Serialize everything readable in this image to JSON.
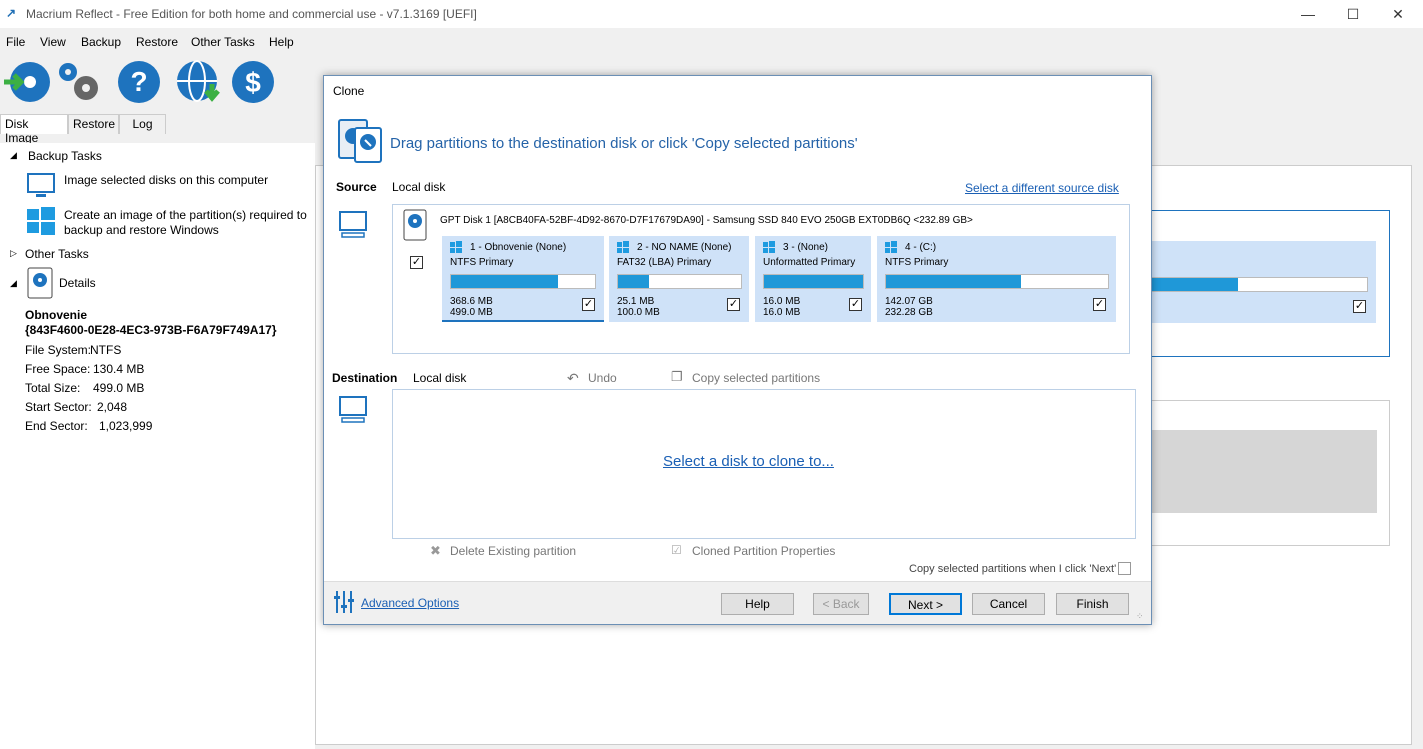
{
  "titlebar": {
    "title": "Macrium Reflect - Free Edition for both home and commercial use - v7.1.3169  [UEFI]"
  },
  "menu": [
    "File",
    "View",
    "Backup",
    "Restore",
    "Other Tasks",
    "Help"
  ],
  "left_tabs": [
    "Disk Image",
    "Restore",
    "Log"
  ],
  "left": {
    "backup_tasks": "Backup Tasks",
    "task1": "Image selected disks on this computer",
    "task2a": "Create an image of the partition(s) required to",
    "task2b": "backup and restore Windows",
    "other_tasks": "Other Tasks",
    "details": "Details",
    "part_name": "Obnovenie",
    "part_guid": "{843F4600-0E28-4EC3-973B-F6A79F749A17}",
    "fs_label": "File System:",
    "fs_value": "NTFS",
    "free_label": "Free Space:",
    "free_value": "130.4 MB",
    "total_label": "Total Size:",
    "total_value": "499.0 MB",
    "start_label": "Start Sector:",
    "start_value": "2,048",
    "end_label": "End Sector:",
    "end_value": "1,023,999"
  },
  "dialog": {
    "title": "Clone",
    "header": "Drag partitions to the destination disk or click 'Copy selected partitions'",
    "source_label": "Source",
    "source_disk_type": "Local disk",
    "select_source": "Select a different source disk",
    "disk_info": "GPT Disk 1 [A8CB40FA-52BF-4D92-8670-D7F17679DA90] - Samsung SSD 840 EVO 250GB EXT0DB6Q  <232.89 GB>",
    "partitions": [
      {
        "name": "1 - Obnovenie (None)",
        "type": "NTFS Primary",
        "used": "368.6 MB",
        "total": "499.0 MB",
        "fill": 0.74
      },
      {
        "name": "2 - NO NAME (None)",
        "type": "FAT32 (LBA) Primary",
        "used": "25.1 MB",
        "total": "100.0 MB",
        "fill": 0.25
      },
      {
        "name": "3 -  (None)",
        "type": "Unformatted Primary",
        "used": "16.0 MB",
        "total": "16.0 MB",
        "fill": 1.0
      },
      {
        "name": "4 -  (C:)",
        "type": "NTFS Primary",
        "used": "142.07 GB",
        "total": "232.28 GB",
        "fill": 0.61
      }
    ],
    "destination_label": "Destination",
    "dest_disk_type": "Local disk",
    "undo": "Undo",
    "copy_selected": "Copy selected partitions",
    "select_clone": "Select a disk to clone to...",
    "delete_existing": "Delete Existing partition",
    "cloned_props": "Cloned Partition Properties",
    "copy_when_next": "Copy selected partitions when I click 'Next'",
    "advanced": "Advanced Options",
    "buttons": {
      "help": "Help",
      "back": "< Back",
      "next": "Next >",
      "cancel": "Cancel",
      "finish": "Finish"
    }
  }
}
